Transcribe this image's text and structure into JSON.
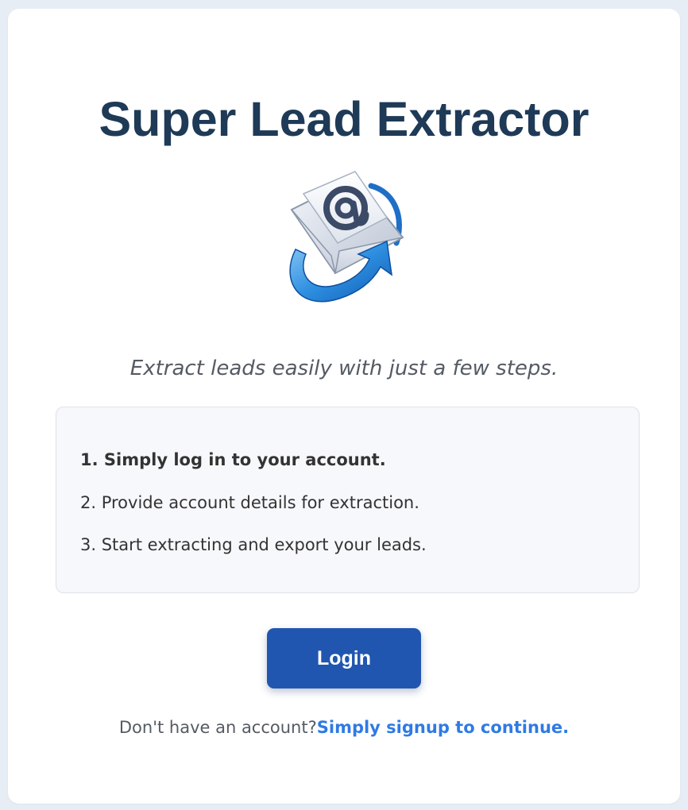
{
  "app": {
    "title": "Super Lead Extractor",
    "tagline": "Extract leads easily with just a few steps.",
    "logo_icon": "email-envelope-at-icon"
  },
  "steps": [
    {
      "text": "1. Simply log in to your account.",
      "bold": true
    },
    {
      "text": "2. Provide account details for extraction.",
      "bold": false
    },
    {
      "text": "3. Start extracting and export your leads.",
      "bold": false
    }
  ],
  "actions": {
    "login_label": "Login",
    "signup_prompt": "Don't have an account?",
    "signup_link": "Simply signup to continue."
  },
  "colors": {
    "page_background": "#e6edf5",
    "title": "#1e3a57",
    "button": "#2056b0",
    "link": "#2f7ae5"
  }
}
